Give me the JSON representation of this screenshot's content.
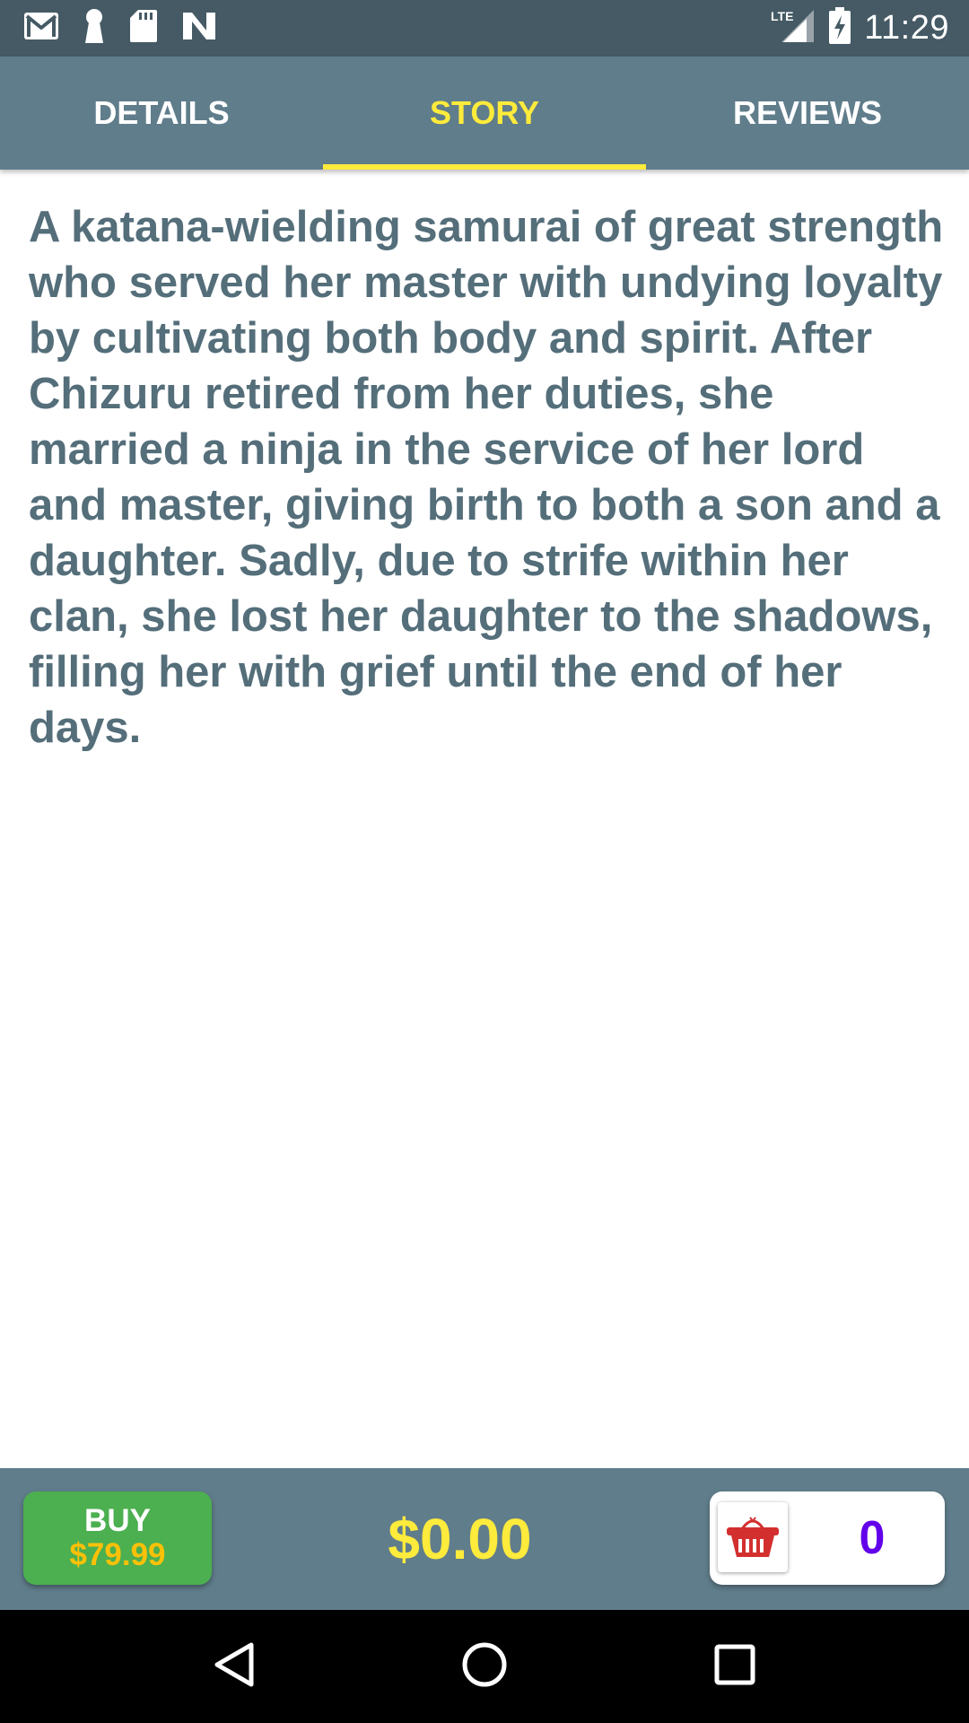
{
  "status_bar": {
    "time": "11:29",
    "network": "LTE",
    "icons": [
      "gmail-icon",
      "keyhole-icon",
      "sd-card-icon",
      "n-logo-icon",
      "lte-signal-icon",
      "battery-charging-icon"
    ]
  },
  "tabs": [
    {
      "label": "DETAILS",
      "active": false
    },
    {
      "label": "STORY",
      "active": true
    },
    {
      "label": "REVIEWS",
      "active": false
    }
  ],
  "story": {
    "text": "A katana-wielding samurai of great strength who served her master with undying loyalty by cultivating both body and spirit. After Chizuru retired from her duties, she married a ninja in the service of her lord and master, giving birth to both a son and a daughter. Sadly, due to strife within her clan, she lost her daughter to the shadows, filling her with grief until the end of her days."
  },
  "bottom_bar": {
    "buy_label": "BUY",
    "buy_price": "$79.99",
    "total": "$0.00",
    "cart_count": "0"
  },
  "colors": {
    "status_bar": "#455a64",
    "tab_bar": "#607d8b",
    "active_tab": "#ffeb3b",
    "story_text": "#546e7a",
    "buy_button": "#4caf50",
    "buy_price": "#ffc107",
    "total": "#ffeb3b",
    "cart_count": "#6200ea",
    "basket": "#d32f2f"
  },
  "nav_bar": {
    "icons": [
      "back-icon",
      "home-icon",
      "recents-icon"
    ]
  }
}
